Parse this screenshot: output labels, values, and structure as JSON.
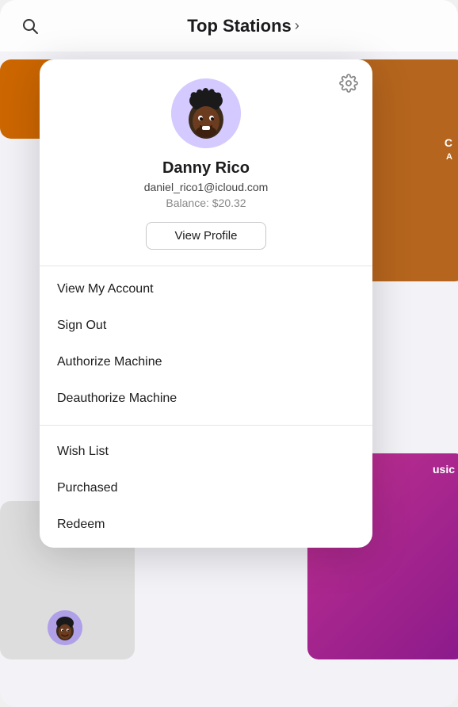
{
  "header": {
    "title": "Top Stations",
    "chevron": "›",
    "search_label": "search"
  },
  "profile": {
    "name": "Danny Rico",
    "email": "daniel_rico1@icloud.com",
    "balance_label": "Balance: $20.32",
    "view_profile_btn": "View Profile"
  },
  "menu": {
    "section1": [
      {
        "label": "View My Account"
      },
      {
        "label": "Sign Out"
      },
      {
        "label": "Authorize Machine"
      },
      {
        "label": "Deauthorize Machine"
      }
    ],
    "section2": [
      {
        "label": "Wish List"
      },
      {
        "label": "Purchased"
      },
      {
        "label": "Redeem"
      }
    ]
  },
  "icons": {
    "search": "⌕",
    "gear": "⚙",
    "chevron_right": "›"
  }
}
